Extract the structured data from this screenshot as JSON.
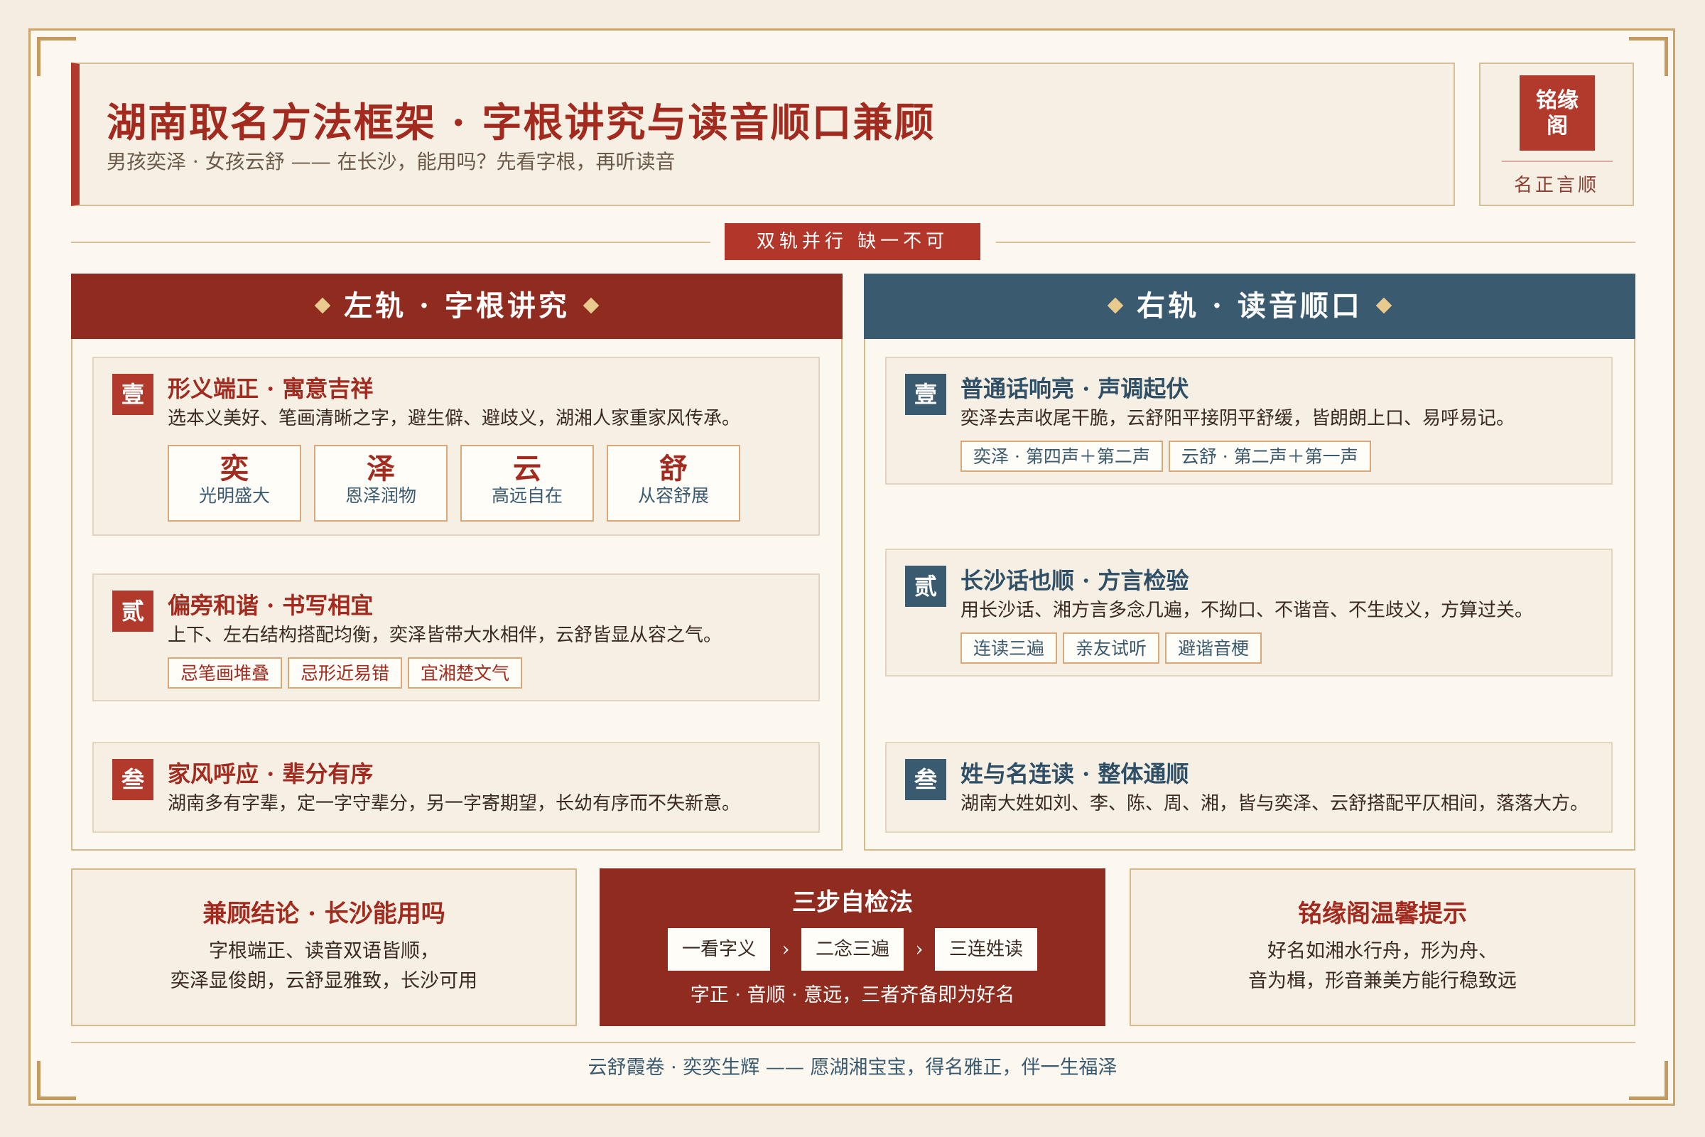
{
  "header": {
    "title": "湖南取名方法框架 · 字根讲究与读音顺口兼顾",
    "subtitle": "男孩奕泽 · 女孩云舒 —— 在长沙，能用吗？先看字根，再听读音"
  },
  "seal": {
    "text_line1": "铭缘",
    "text_line2": "阁",
    "motto": "名正言顺"
  },
  "ribbon": "双轨并行 缺一不可",
  "left": {
    "heading": "左轨 · 字根讲究",
    "cards": [
      {
        "badge": "壹",
        "title": "形义端正 · 寓意吉祥",
        "desc": "选本义美好、笔画清晰之字，避生僻、避歧义，湖湘人家重家风传承。",
        "chars": [
          {
            "char": "奕",
            "meaning": "光明盛大"
          },
          {
            "char": "泽",
            "meaning": "恩泽润物"
          },
          {
            "char": "云",
            "meaning": "高远自在"
          },
          {
            "char": "舒",
            "meaning": "从容舒展"
          }
        ]
      },
      {
        "badge": "贰",
        "title": "偏旁和谐 · 书写相宜",
        "desc": "上下、左右结构搭配均衡，奕泽皆带大水相伴，云舒皆显从容之气。",
        "tags": [
          "忌笔画堆叠",
          "忌形近易错",
          "宜湘楚文气"
        ]
      },
      {
        "badge": "叁",
        "title": "家风呼应 · 辈分有序",
        "desc": "湖南多有字辈，定一字守辈分，另一字寄期望，长幼有序而不失新意。"
      }
    ]
  },
  "right": {
    "heading": "右轨 · 读音顺口",
    "cards": [
      {
        "badge": "壹",
        "title": "普通话响亮 · 声调起伏",
        "desc": "奕泽去声收尾干脆，云舒阳平接阴平舒缓，皆朗朗上口、易呼易记。",
        "tags": [
          "奕泽 · 第四声＋第二声",
          "云舒 · 第二声＋第一声"
        ]
      },
      {
        "badge": "贰",
        "title": "长沙话也顺 · 方言检验",
        "desc": "用长沙话、湘方言多念几遍，不拗口、不谐音、不生歧义，方算过关。",
        "tags": [
          "连读三遍",
          "亲友试听",
          "避谐音梗"
        ]
      },
      {
        "badge": "叁",
        "title": "姓与名连读 · 整体通顺",
        "desc": "湖南大姓如刘、李、陈、周、湘，皆与奕泽、云舒搭配平仄相间，落落大方。"
      }
    ]
  },
  "conclusion": {
    "title": "兼顾结论 · 长沙能用吗",
    "line1": "字根端正、读音双语皆顺，",
    "line2": "奕泽显俊朗，云舒显雅致，长沙可用"
  },
  "method": {
    "title": "三步自检法",
    "steps": [
      "一看字义",
      "二念三遍",
      "三连姓读"
    ],
    "arrow": "›",
    "note": "字正 · 音顺 · 意远，三者齐备即为好名"
  },
  "tip": {
    "title": "铭缘阁温馨提示",
    "line1": "好名如湘水行舟，形为舟、",
    "line2": "音为楫，形音兼美方能行稳致远"
  },
  "footer": "云舒霞卷 · 奕奕生辉 —— 愿湖湘宝宝，得名雅正，伴一生福泽",
  "colors": {
    "accent_red": "#8f2b1f",
    "accent_blue": "#3a5a70",
    "gold": "#cfa46a",
    "paper": "#fcf8ef"
  }
}
